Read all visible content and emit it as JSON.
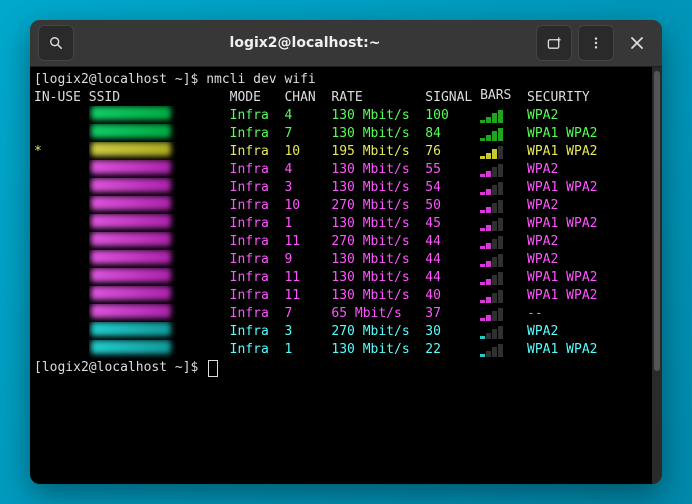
{
  "window": {
    "title": "logix2@localhost:~"
  },
  "prompt": {
    "text": "[logix2@localhost ~]$ "
  },
  "command": "nmcli dev wifi",
  "headers": {
    "inuse": "IN-USE",
    "ssid": "SSID",
    "mode": "MODE",
    "chan": "CHAN",
    "rate": "RATE",
    "signal": "SIGNAL",
    "bars": "BARS",
    "security": "SECURITY"
  },
  "rows": [
    {
      "inuse": " ",
      "mode": "Infra",
      "chan": "4",
      "rate": "130 Mbit/s",
      "signal": "100",
      "bars": 4,
      "security": "WPA2",
      "color": "g"
    },
    {
      "inuse": " ",
      "mode": "Infra",
      "chan": "7",
      "rate": "130 Mbit/s",
      "signal": "84",
      "bars": 4,
      "security": "WPA1 WPA2",
      "color": "g"
    },
    {
      "inuse": "*",
      "mode": "Infra",
      "chan": "10",
      "rate": "195 Mbit/s",
      "signal": "76",
      "bars": 3,
      "security": "WPA1 WPA2",
      "color": "y"
    },
    {
      "inuse": " ",
      "mode": "Infra",
      "chan": "4",
      "rate": "130 Mbit/s",
      "signal": "55",
      "bars": 2,
      "security": "WPA2",
      "color": "m"
    },
    {
      "inuse": " ",
      "mode": "Infra",
      "chan": "3",
      "rate": "130 Mbit/s",
      "signal": "54",
      "bars": 2,
      "security": "WPA1 WPA2",
      "color": "m"
    },
    {
      "inuse": " ",
      "mode": "Infra",
      "chan": "10",
      "rate": "270 Mbit/s",
      "signal": "50",
      "bars": 2,
      "security": "WPA2",
      "color": "m"
    },
    {
      "inuse": " ",
      "mode": "Infra",
      "chan": "1",
      "rate": "130 Mbit/s",
      "signal": "45",
      "bars": 2,
      "security": "WPA1 WPA2",
      "color": "m"
    },
    {
      "inuse": " ",
      "mode": "Infra",
      "chan": "11",
      "rate": "270 Mbit/s",
      "signal": "44",
      "bars": 2,
      "security": "WPA2",
      "color": "m"
    },
    {
      "inuse": " ",
      "mode": "Infra",
      "chan": "9",
      "rate": "130 Mbit/s",
      "signal": "44",
      "bars": 2,
      "security": "WPA2",
      "color": "m"
    },
    {
      "inuse": " ",
      "mode": "Infra",
      "chan": "11",
      "rate": "130 Mbit/s",
      "signal": "44",
      "bars": 2,
      "security": "WPA1 WPA2",
      "color": "m"
    },
    {
      "inuse": " ",
      "mode": "Infra",
      "chan": "11",
      "rate": "130 Mbit/s",
      "signal": "40",
      "bars": 2,
      "security": "WPA1 WPA2",
      "color": "m"
    },
    {
      "inuse": " ",
      "mode": "Infra",
      "chan": "7",
      "rate": "65 Mbit/s",
      "signal": "37",
      "bars": 2,
      "security": "--",
      "color": "m"
    },
    {
      "inuse": " ",
      "mode": "Infra",
      "chan": "3",
      "rate": "270 Mbit/s",
      "signal": "30",
      "bars": 1,
      "security": "WPA2",
      "color": "c"
    },
    {
      "inuse": " ",
      "mode": "Infra",
      "chan": "1",
      "rate": "130 Mbit/s",
      "signal": "22",
      "bars": 1,
      "security": "WPA1 WPA2",
      "color": "c"
    }
  ]
}
